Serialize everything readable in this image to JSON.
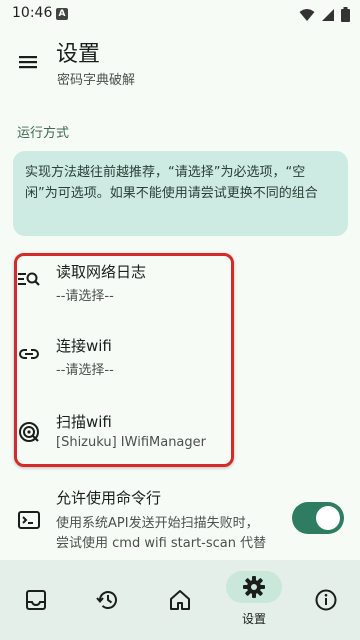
{
  "status_bar": {
    "time": "10:46",
    "indicator": "A"
  },
  "header": {
    "title": "设置",
    "subtitle": "密码字典破解"
  },
  "section": {
    "label": "运行方式"
  },
  "info": {
    "text": "实现方法越往前越推荐，“请选择”为必选项，“空闲”为可选项。如果不能使用请尝试更换不同的组合"
  },
  "items": [
    {
      "title": "读取网络日志",
      "subtitle": "--请选择--",
      "icon": "log-search-icon"
    },
    {
      "title": "连接wifi",
      "subtitle": "--请选择--",
      "icon": "link-icon"
    },
    {
      "title": "扫描wifi",
      "subtitle": "[Shizuku] IWifiManager",
      "icon": "scan-target-icon"
    },
    {
      "title": "允许使用命令行",
      "subtitle_line1": "使用系统API发送开始扫描失败时，",
      "subtitle_line2": "尝试使用 cmd wifi start-scan 代替",
      "icon": "terminal-icon",
      "toggle_on": true
    }
  ],
  "bottom_nav": {
    "items": [
      {
        "icon": "inbox-icon",
        "label": ""
      },
      {
        "icon": "history-icon",
        "label": ""
      },
      {
        "icon": "home-icon",
        "label": ""
      },
      {
        "icon": "gear-icon",
        "label": "设置",
        "selected": true
      },
      {
        "icon": "info-icon",
        "label": ""
      }
    ]
  },
  "colors": {
    "background": "#f6fbf6",
    "accent": "#2e7d62",
    "info_box": "#cdebe2",
    "highlight": "#d42a2a",
    "nav_background": "#e4efea"
  }
}
